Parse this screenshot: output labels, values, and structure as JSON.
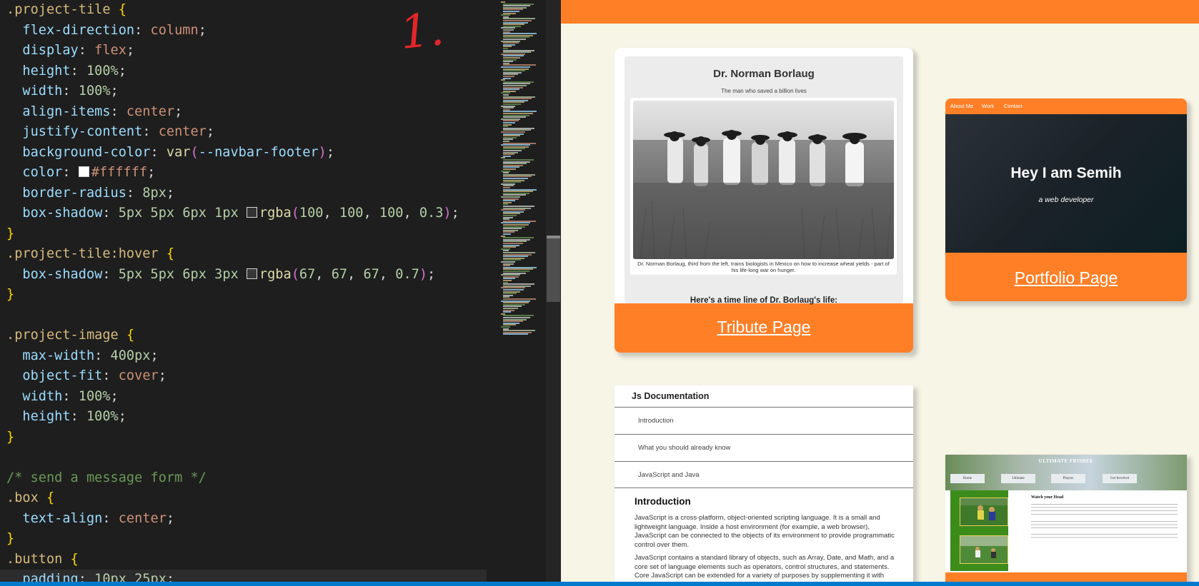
{
  "editor": {
    "lines": [
      {
        "tokens": [
          {
            "c": "sel",
            "t": ".project-tile"
          },
          {
            "c": "",
            "t": " "
          },
          {
            "c": "br1",
            "t": "{"
          }
        ]
      },
      {
        "tokens": [
          {
            "c": "",
            "t": "  "
          },
          {
            "c": "prop",
            "t": "flex-direction"
          },
          {
            "c": "",
            "t": ": "
          },
          {
            "c": "val",
            "t": "column"
          },
          {
            "c": "",
            "t": ";"
          }
        ]
      },
      {
        "tokens": [
          {
            "c": "",
            "t": "  "
          },
          {
            "c": "prop",
            "t": "display"
          },
          {
            "c": "",
            "t": ": "
          },
          {
            "c": "val",
            "t": "flex"
          },
          {
            "c": "",
            "t": ";"
          }
        ]
      },
      {
        "tokens": [
          {
            "c": "",
            "t": "  "
          },
          {
            "c": "prop",
            "t": "height"
          },
          {
            "c": "",
            "t": ": "
          },
          {
            "c": "num",
            "t": "100%"
          },
          {
            "c": "",
            "t": ";"
          }
        ]
      },
      {
        "tokens": [
          {
            "c": "",
            "t": "  "
          },
          {
            "c": "prop",
            "t": "width"
          },
          {
            "c": "",
            "t": ": "
          },
          {
            "c": "num",
            "t": "100%"
          },
          {
            "c": "",
            "t": ";"
          }
        ]
      },
      {
        "tokens": [
          {
            "c": "",
            "t": "  "
          },
          {
            "c": "prop",
            "t": "align-items"
          },
          {
            "c": "",
            "t": ": "
          },
          {
            "c": "val",
            "t": "center"
          },
          {
            "c": "",
            "t": ";"
          }
        ]
      },
      {
        "tokens": [
          {
            "c": "",
            "t": "  "
          },
          {
            "c": "prop",
            "t": "justify-content"
          },
          {
            "c": "",
            "t": ": "
          },
          {
            "c": "val",
            "t": "center"
          },
          {
            "c": "",
            "t": ";"
          }
        ]
      },
      {
        "tokens": [
          {
            "c": "",
            "t": "  "
          },
          {
            "c": "prop",
            "t": "background-color"
          },
          {
            "c": "",
            "t": ": "
          },
          {
            "c": "fn",
            "t": "var"
          },
          {
            "c": "br2",
            "t": "("
          },
          {
            "c": "var",
            "t": "--navbar-footer"
          },
          {
            "c": "br2",
            "t": ")"
          },
          {
            "c": "",
            "t": ";"
          }
        ]
      },
      {
        "tokens": [
          {
            "c": "",
            "t": "  "
          },
          {
            "c": "prop",
            "t": "color"
          },
          {
            "c": "",
            "t": ": "
          },
          {
            "c": "swatch",
            "t": "#ffffff"
          },
          {
            "c": "val",
            "t": "#ffffff"
          },
          {
            "c": "",
            "t": ";"
          }
        ]
      },
      {
        "tokens": [
          {
            "c": "",
            "t": "  "
          },
          {
            "c": "prop",
            "t": "border-radius"
          },
          {
            "c": "",
            "t": ": "
          },
          {
            "c": "num",
            "t": "8px"
          },
          {
            "c": "",
            "t": ";"
          }
        ]
      },
      {
        "tokens": [
          {
            "c": "",
            "t": "  "
          },
          {
            "c": "prop",
            "t": "box-shadow"
          },
          {
            "c": "",
            "t": ": "
          },
          {
            "c": "num",
            "t": "5px"
          },
          {
            "c": "",
            "t": " "
          },
          {
            "c": "num",
            "t": "5px"
          },
          {
            "c": "",
            "t": " "
          },
          {
            "c": "num",
            "t": "6px"
          },
          {
            "c": "",
            "t": " "
          },
          {
            "c": "num",
            "t": "1px"
          },
          {
            "c": "",
            "t": " "
          },
          {
            "c": "swatch",
            "t": "rgba(100, 100, 100, 0.3)"
          },
          {
            "c": "fn",
            "t": "rgba"
          },
          {
            "c": "br2",
            "t": "("
          },
          {
            "c": "num",
            "t": "100"
          },
          {
            "c": "",
            "t": ", "
          },
          {
            "c": "num",
            "t": "100"
          },
          {
            "c": "",
            "t": ", "
          },
          {
            "c": "num",
            "t": "100"
          },
          {
            "c": "",
            "t": ", "
          },
          {
            "c": "num",
            "t": "0.3"
          },
          {
            "c": "br2",
            "t": ")"
          },
          {
            "c": "",
            "t": ";"
          }
        ]
      },
      {
        "tokens": [
          {
            "c": "br1",
            "t": "}"
          }
        ]
      },
      {
        "tokens": [
          {
            "c": "sel",
            "t": ".project-tile:hover"
          },
          {
            "c": "",
            "t": " "
          },
          {
            "c": "br1",
            "t": "{"
          }
        ]
      },
      {
        "tokens": [
          {
            "c": "",
            "t": "  "
          },
          {
            "c": "prop",
            "t": "box-shadow"
          },
          {
            "c": "",
            "t": ": "
          },
          {
            "c": "num",
            "t": "5px"
          },
          {
            "c": "",
            "t": " "
          },
          {
            "c": "num",
            "t": "5px"
          },
          {
            "c": "",
            "t": " "
          },
          {
            "c": "num",
            "t": "6px"
          },
          {
            "c": "",
            "t": " "
          },
          {
            "c": "num",
            "t": "3px"
          },
          {
            "c": "",
            "t": " "
          },
          {
            "c": "swatch",
            "t": "rgba(67, 67, 67, 0.7)"
          },
          {
            "c": "fn",
            "t": "rgba"
          },
          {
            "c": "br2",
            "t": "("
          },
          {
            "c": "num",
            "t": "67"
          },
          {
            "c": "",
            "t": ", "
          },
          {
            "c": "num",
            "t": "67"
          },
          {
            "c": "",
            "t": ", "
          },
          {
            "c": "num",
            "t": "67"
          },
          {
            "c": "",
            "t": ", "
          },
          {
            "c": "num",
            "t": "0.7"
          },
          {
            "c": "br2",
            "t": ")"
          },
          {
            "c": "",
            "t": ";"
          }
        ]
      },
      {
        "tokens": [
          {
            "c": "br1",
            "t": "}"
          }
        ]
      },
      {
        "tokens": []
      },
      {
        "tokens": [
          {
            "c": "sel",
            "t": ".project-image"
          },
          {
            "c": "",
            "t": " "
          },
          {
            "c": "br1",
            "t": "{"
          }
        ]
      },
      {
        "tokens": [
          {
            "c": "",
            "t": "  "
          },
          {
            "c": "prop",
            "t": "max-width"
          },
          {
            "c": "",
            "t": ": "
          },
          {
            "c": "num",
            "t": "400px"
          },
          {
            "c": "",
            "t": ";"
          }
        ]
      },
      {
        "tokens": [
          {
            "c": "",
            "t": "  "
          },
          {
            "c": "prop",
            "t": "object-fit"
          },
          {
            "c": "",
            "t": ": "
          },
          {
            "c": "val",
            "t": "cover"
          },
          {
            "c": "",
            "t": ";"
          }
        ]
      },
      {
        "tokens": [
          {
            "c": "",
            "t": "  "
          },
          {
            "c": "prop",
            "t": "width"
          },
          {
            "c": "",
            "t": ": "
          },
          {
            "c": "num",
            "t": "100%"
          },
          {
            "c": "",
            "t": ";"
          }
        ]
      },
      {
        "tokens": [
          {
            "c": "",
            "t": "  "
          },
          {
            "c": "prop",
            "t": "height"
          },
          {
            "c": "",
            "t": ": "
          },
          {
            "c": "num",
            "t": "100%"
          },
          {
            "c": "",
            "t": ";"
          }
        ]
      },
      {
        "tokens": [
          {
            "c": "br1",
            "t": "}"
          }
        ]
      },
      {
        "tokens": []
      },
      {
        "tokens": [
          {
            "c": "cmt",
            "t": "/* send a message form */"
          }
        ]
      },
      {
        "tokens": [
          {
            "c": "sel",
            "t": ".box"
          },
          {
            "c": "",
            "t": " "
          },
          {
            "c": "br1",
            "t": "{"
          }
        ]
      },
      {
        "tokens": [
          {
            "c": "",
            "t": "  "
          },
          {
            "c": "prop",
            "t": "text-align"
          },
          {
            "c": "",
            "t": ": "
          },
          {
            "c": "val",
            "t": "center"
          },
          {
            "c": "",
            "t": ";"
          }
        ]
      },
      {
        "tokens": [
          {
            "c": "br1",
            "t": "}"
          }
        ]
      },
      {
        "tokens": [
          {
            "c": "sel",
            "t": ".button"
          },
          {
            "c": "",
            "t": " "
          },
          {
            "c": "br1",
            "t": "{"
          }
        ]
      },
      {
        "tokens": [
          {
            "c": "",
            "t": "  "
          },
          {
            "c": "prop",
            "t": "padding"
          },
          {
            "c": "",
            "t": ": "
          },
          {
            "c": "num",
            "t": "10px"
          },
          {
            "c": "",
            "t": " "
          },
          {
            "c": "num",
            "t": "25px"
          },
          {
            "c": "",
            "t": ";"
          }
        ],
        "current": true
      }
    ],
    "annotation": "1."
  },
  "colors": {
    "orange": "#ff7f27",
    "cream": "#f7f5e6",
    "status_bar": "#007acc",
    "frisbee_green": "#3c8c1c"
  },
  "tribute": {
    "title": "Dr. Norman Borlaug",
    "subtitle": "The man who saved a billion lives",
    "caption": "Dr. Norman Borlaug, third from the left, trains biologists in Mexico on how to increase wheat yields - part of his life-long war on hunger.",
    "timeline_heading": "Here's a time line of Dr. Borlaug's life:",
    "link": "Tribute Page"
  },
  "portfolio": {
    "nav": [
      "About Me",
      "Work",
      "Contact"
    ],
    "hero_title": "Hey I am Semih",
    "hero_subtitle": "a web developer",
    "link": "Portfolio Page"
  },
  "docs": {
    "title": "Js Documentation",
    "nav": [
      "Introduction",
      "What you should already know",
      "JavaScript and Java"
    ],
    "section_heading": "Introduction",
    "para1": "JavaScript is a cross-platform, object-oriented scripting language. It is a small and lightweight language. Inside a host environment (for example, a web browser), JavaScript can be connected to the objects of its environment to provide programmatic control over them.",
    "para2": "JavaScript contains a standard library of objects, such as Array, Date, and Math, and a core set of language elements such as operators, control structures, and statements. Core JavaScript can be extended for a variety of purposes by supplementing it with additional"
  },
  "frisbee": {
    "title": "ULTIMATE FRISBEE",
    "buttons": [
      "Home",
      "Ultimate",
      "Players",
      "Get Involved"
    ],
    "heading": "Watch your Head"
  }
}
